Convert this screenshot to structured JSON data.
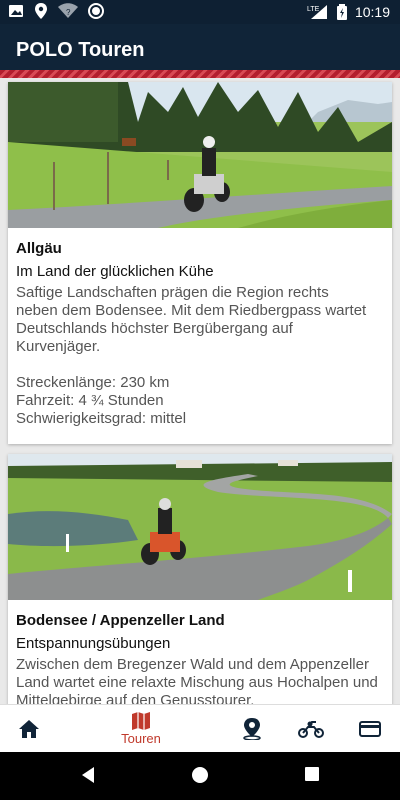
{
  "statusbar": {
    "time": "10:19",
    "network": "LTE"
  },
  "appbar": {
    "title": "POLO Touren"
  },
  "cards": [
    {
      "name": "Allgäu",
      "subtitle": "Im Land der glücklichen Kühe",
      "description": "Saftige Landschaften prägen die Region rechts neben dem Bodensee. Mit dem Riedbergpass wartet Deutschlands höchster Bergübergang auf Kurvenjäger.",
      "length": "Streckenlänge:  230 km",
      "duration": "Fahrzeit: 4 ¾  Stunden",
      "difficulty": "Schwierigkeitsgrad: mittel"
    },
    {
      "name": "Bodensee / Appenzeller Land",
      "subtitle": "Entspannungsübungen",
      "description": "Zwischen dem Bregenzer Wald und dem Appenzeller Land wartet eine relaxte Mischung aus Hochalpen und Mittelgebirge auf den Genusstourer."
    }
  ],
  "bottomnav": {
    "tours_label": "Touren",
    "active_color": "#c0392b",
    "icon_color": "#102438"
  },
  "colors": {
    "brand": "#102438",
    "accent": "#b31e2e"
  }
}
